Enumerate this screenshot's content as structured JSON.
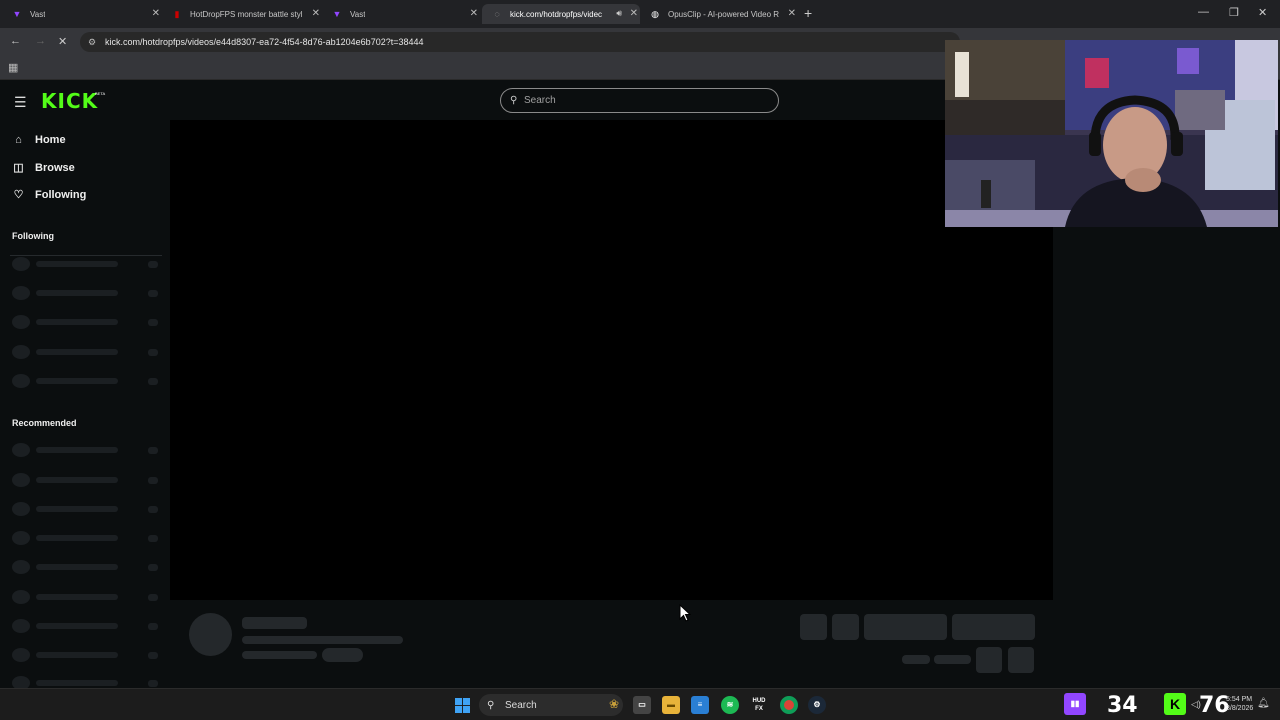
{
  "browser": {
    "tabs": [
      {
        "title": "Vast",
        "icon": "vast-icon"
      },
      {
        "title": "HotDropFPS monster battle styl",
        "icon": "youtube-icon"
      },
      {
        "title": "Vast",
        "icon": "vast-icon"
      },
      {
        "title": "kick.com/hotdropfps/videc",
        "icon": "kick-icon",
        "active": true
      },
      {
        "title": "OpusClip - AI-powered Video R",
        "icon": "opusclip-icon"
      }
    ],
    "url": "kick.com/hotdropfps/videos/e44d8307-ea72-4f54-8d76-ab1204e6b702?t=38444"
  },
  "kick": {
    "logo": "KICK",
    "beta": "BETA",
    "search_placeholder": "Search",
    "accent": "#53fc18",
    "nav": [
      {
        "label": "Home",
        "icon": "home-icon"
      },
      {
        "label": "Browse",
        "icon": "compass-icon"
      },
      {
        "label": "Following",
        "icon": "heart-icon"
      }
    ],
    "sections": {
      "following": "Following",
      "recommended": "Recommended"
    }
  },
  "taskbar": {
    "search_label": "Search",
    "apps": [
      "file-explorer-icon",
      "notepad-icon",
      "spotify-icon",
      "hud-icon",
      "chrome-icon",
      "steam-icon"
    ],
    "hud_label": "HUD FX",
    "tray": {
      "twitch_count": "34",
      "kick_count": "76",
      "time": "5:54 PM",
      "date": "3/8/2026"
    }
  }
}
